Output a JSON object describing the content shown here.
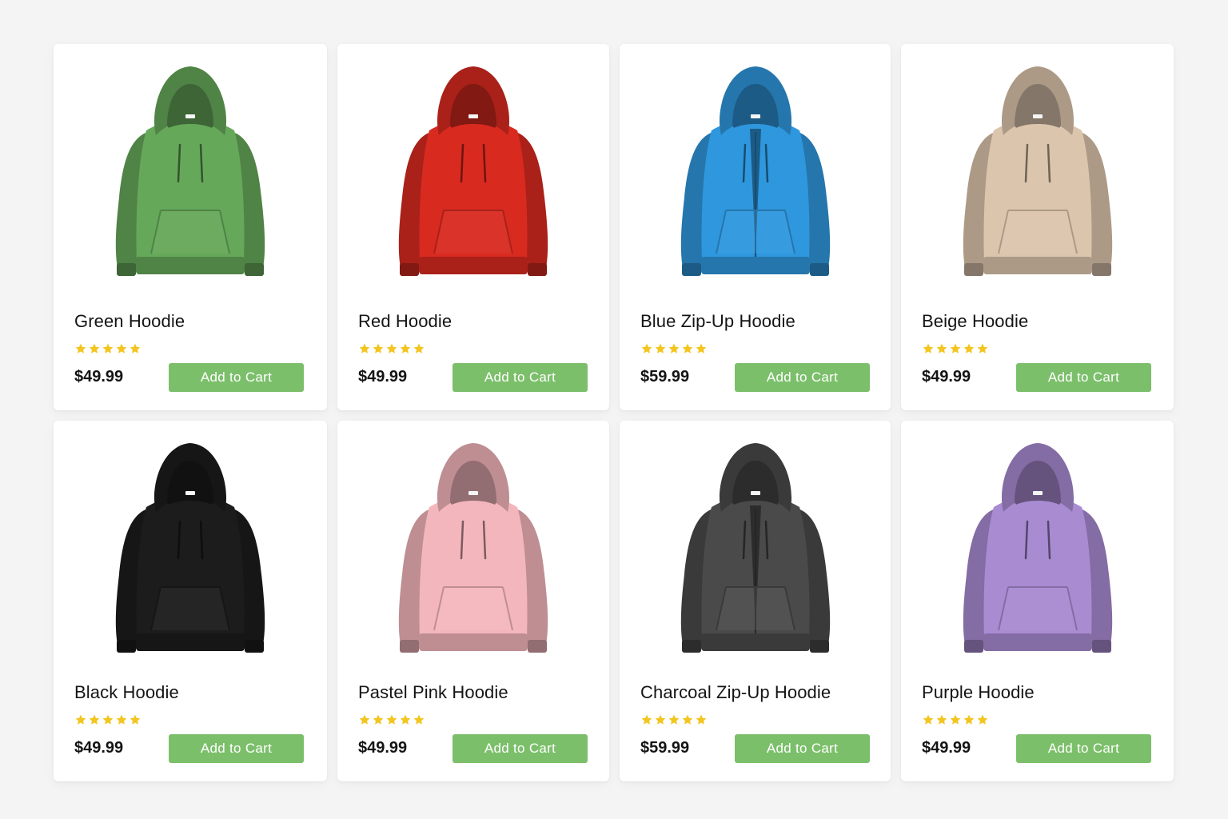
{
  "products": [
    {
      "name": "Green Hoodie",
      "price": "$49.99",
      "rating": 5,
      "color": "#66a85a",
      "style": "pullover",
      "button": "Add to Cart",
      "image_icon": "hoodie-icon"
    },
    {
      "name": "Red Hoodie",
      "price": "$49.99",
      "rating": 5,
      "color": "#d92a20",
      "style": "pullover",
      "button": "Add to Cart",
      "image_icon": "hoodie-icon"
    },
    {
      "name": "Blue Zip-Up Hoodie",
      "price": "$59.99",
      "rating": 5,
      "color": "#2f97dd",
      "style": "zip-up",
      "button": "Add to Cart",
      "image_icon": "hoodie-icon"
    },
    {
      "name": "Beige Hoodie",
      "price": "$49.99",
      "rating": 5,
      "color": "#dcc5ad",
      "style": "pullover",
      "button": "Add to Cart",
      "image_icon": "hoodie-icon"
    },
    {
      "name": "Black Hoodie",
      "price": "$49.99",
      "rating": 5,
      "color": "#1c1c1c",
      "style": "pullover",
      "button": "Add to Cart",
      "image_icon": "hoodie-icon"
    },
    {
      "name": "Pastel Pink Hoodie",
      "price": "$49.99",
      "rating": 5,
      "color": "#f4b6bd",
      "style": "pullover",
      "button": "Add to Cart",
      "image_icon": "hoodie-icon"
    },
    {
      "name": "Charcoal Zip-Up Hoodie",
      "price": "$59.99",
      "rating": 5,
      "color": "#4a4a4a",
      "style": "zip-up",
      "button": "Add to Cart",
      "image_icon": "hoodie-icon"
    },
    {
      "name": "Purple Hoodie",
      "price": "$49.99",
      "rating": 5,
      "color": "#a98bd2",
      "style": "pullover",
      "button": "Add to Cart",
      "image_icon": "hoodie-icon"
    }
  ],
  "colors": {
    "star": "#f3c51f",
    "button_bg": "#7cbf6b",
    "button_text": "#ffffff",
    "card_bg": "#ffffff",
    "page_bg": "#f4f4f5"
  }
}
